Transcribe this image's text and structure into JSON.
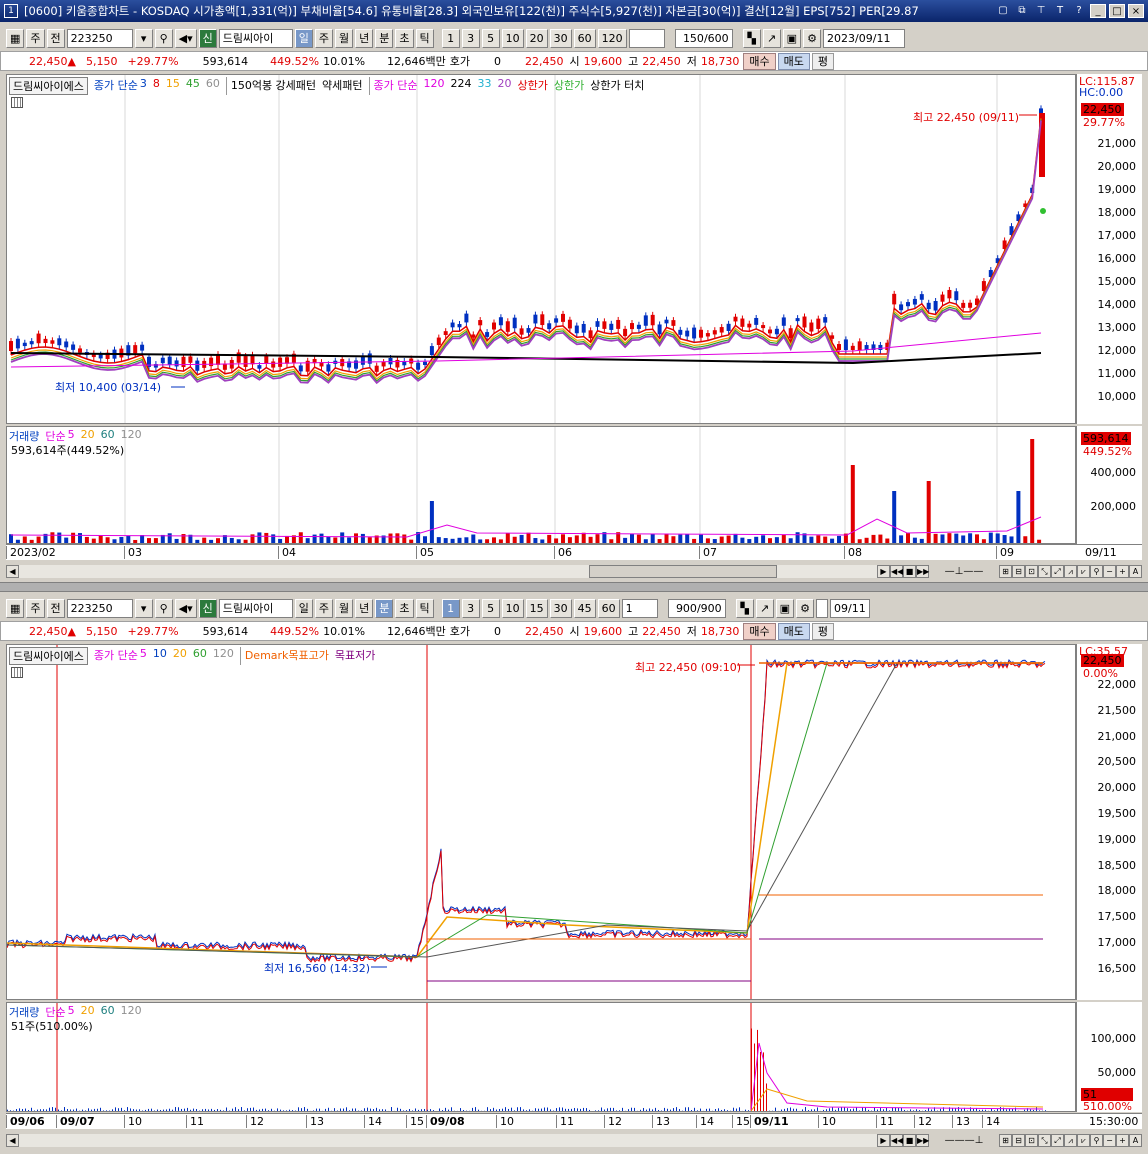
{
  "window": {
    "icon": "1",
    "title": "[0600] 키움종합차트 - KOSDAQ 시가총액[1,331(억)] 부채비율[54.6] 유통비율[28.3] 외국인보유[122(천)] 주식수[5,927(천)] 자본금[30(억)] 결산[12월] EPS[752] PER[29.87"
  },
  "top": {
    "toolbar": {
      "period": "주",
      "prev": "전",
      "code": "223250",
      "shin": "신",
      "name": "드림씨아이",
      "tabs": [
        "일",
        "주",
        "월",
        "년",
        "분",
        "초",
        "틱"
      ],
      "nums": [
        "1",
        "3",
        "5",
        "10",
        "20",
        "30",
        "60",
        "120"
      ],
      "count": "150",
      "total": "/600",
      "date": "2023/09/11"
    },
    "info": {
      "price": "22,450",
      "change": "5,150",
      "rate": "+29.77%",
      "volume": "593,614",
      "vol_rate": "449.52%",
      "turnover": "10.01%",
      "amount": "12,646백만",
      "hoga_label": "호가",
      "hoga": "0",
      "quote": "22,450",
      "open_label": "시",
      "open": "19,600",
      "high_label": "고",
      "high": "22,450",
      "low_label": "저",
      "low": "18,730",
      "buy": "매수",
      "sell": "매도",
      "flat": "평"
    },
    "legend": {
      "name": "드림씨아이에스",
      "ma_label": "종가 단순",
      "ma": [
        "3",
        "8",
        "15",
        "45",
        "60"
      ],
      "pattern": "150억봉 강세패턴",
      "weak": "약세패턴",
      "ma2_label": "종가 단순",
      "ma2": [
        "120",
        "224",
        "33",
        "20"
      ],
      "upper": "상한가",
      "upper2": "상한가",
      "touch": "상한가 터치"
    },
    "axis": [
      "21,000",
      "20,000",
      "19,000",
      "18,000",
      "17,000",
      "16,000",
      "15,000",
      "14,000",
      "13,000",
      "12,000",
      "11,000",
      "10,000"
    ],
    "lc": "LC:115.87",
    "hc": "HC:0.00",
    "price_tag": "22,450",
    "pct_tag": "29.77%",
    "high_note": "최고 22,450 (09/11)",
    "low_note": "최저 10,400 (03/14)",
    "vol_legend": {
      "label": "거래량",
      "ma_label": "단순",
      "ma": [
        "5",
        "20",
        "60",
        "120"
      ],
      "value": "593,614주(449.52%)"
    },
    "vol_axis": [
      "400,000",
      "200,000"
    ],
    "vol_tag": "593,614",
    "vol_pct": "449.52%",
    "dates": [
      "2023/02",
      "03",
      "04",
      "05",
      "06",
      "07",
      "08",
      "09"
    ],
    "date_end": "09/11"
  },
  "bottom": {
    "toolbar": {
      "period": "주",
      "prev": "전",
      "code": "223250",
      "shin": "신",
      "name": "드림씨아이",
      "tabs": [
        "일",
        "주",
        "월",
        "년",
        "분",
        "초",
        "틱"
      ],
      "nums": [
        "1",
        "3",
        "5",
        "10",
        "15",
        "30",
        "45",
        "60"
      ],
      "interval": "1",
      "count": "900",
      "total": "/900",
      "date": "09/11"
    },
    "info": {
      "price": "22,450",
      "change": "5,150",
      "rate": "+29.77%",
      "volume": "593,614",
      "vol_rate": "449.52%",
      "turnover": "10.01%",
      "amount": "12,646백만",
      "hoga_label": "호가",
      "hoga": "0",
      "quote": "22,450",
      "open_label": "시",
      "open": "19,600",
      "high_label": "고",
      "high": "22,450",
      "low_label": "저",
      "low": "18,730",
      "buy": "매수",
      "sell": "매도",
      "flat": "평"
    },
    "legend": {
      "name": "드림씨아이에스",
      "ma_label": "종가 단순",
      "ma": [
        "5",
        "10",
        "20",
        "60",
        "120"
      ],
      "demark_hi": "Demark목표고가",
      "demark_lo": "목표저가"
    },
    "axis": [
      "22,000",
      "21,500",
      "21,000",
      "20,500",
      "20,000",
      "19,500",
      "19,000",
      "18,500",
      "18,000",
      "17,500",
      "17,000",
      "16,500"
    ],
    "lc": "LC:35.57",
    "price_tag": "22,450",
    "pct_tag": "0.00%",
    "high_note": "최고 22,450 (09:10)",
    "low_note": "최저 16,560 (14:32)",
    "vol_legend": {
      "label": "거래량",
      "ma_label": "단순",
      "ma": [
        "5",
        "20",
        "60",
        "120"
      ],
      "value": "51주(510.00%)"
    },
    "vol_axis": [
      "100,000",
      "50,000"
    ],
    "vol_tag": "51",
    "vol_pct": "510.00%",
    "dates": [
      "09/06",
      "09/07",
      "10",
      "11",
      "12",
      "13",
      "14",
      "15",
      "09/08",
      "10",
      "11",
      "12",
      "13",
      "14",
      "15",
      "09/11",
      "10",
      "11",
      "12",
      "13",
      "14"
    ],
    "date_end": "15:30:00"
  },
  "colors": {
    "up": "#e00000",
    "down": "#0030c0",
    "ma3": "#0030c0",
    "ma8": "#e00000",
    "ma15": "#f0a000",
    "ma45": "#30a030",
    "ma60": "#a0a0a0",
    "ma120": "#e000e0"
  }
}
